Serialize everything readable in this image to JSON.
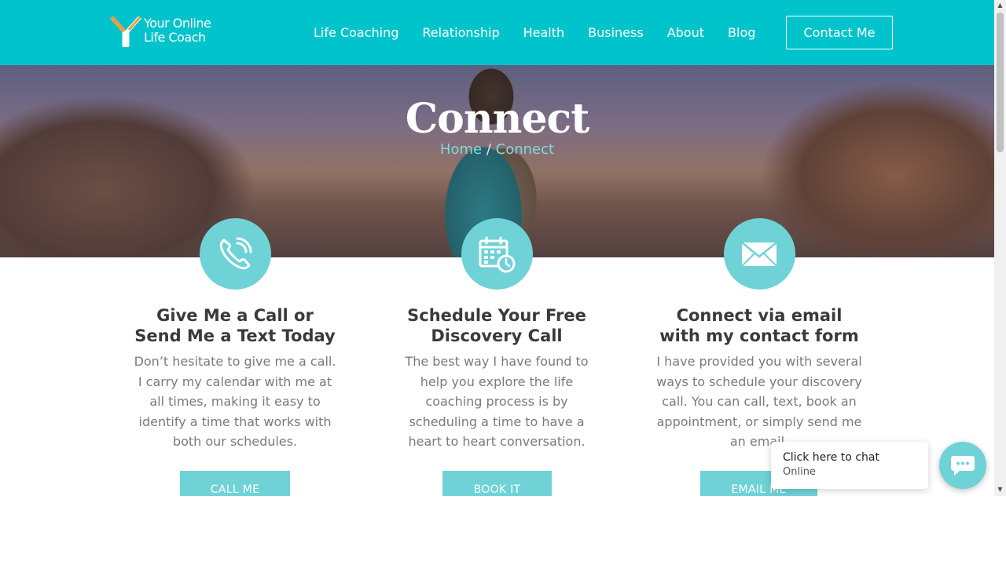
{
  "header": {
    "logo_line1": "Your Online",
    "logo_line2": "Life Coach",
    "nav": [
      "Life Coaching",
      "Relationship",
      "Health",
      "Business",
      "About",
      "Blog"
    ],
    "contact_label": "Contact Me"
  },
  "hero": {
    "title": "Connect",
    "breadcrumb_home": "Home",
    "breadcrumb_sep": "/",
    "breadcrumb_current": "Connect"
  },
  "columns": [
    {
      "icon": "phone-icon",
      "title": "Give Me a Call or Send Me a Text Today",
      "text": "Don’t hesitate to give me a call. I carry my calendar with me at all times, making it easy to identify a time that works with both our schedules.",
      "button": "CALL ME"
    },
    {
      "icon": "calendar-clock-icon",
      "title": "Schedule Your Free Discovery Call",
      "text": "The best way I have found to help you explore the life coaching process is by scheduling a time to have a heart to heart conversation.",
      "button": "BOOK IT"
    },
    {
      "icon": "envelope-icon",
      "title": "Connect via email with my contact form",
      "text": "I have provided you with several ways to schedule your discovery call. You can call, text, book an appointment, or simply send me an email.",
      "button": "EMAIL ME"
    }
  ],
  "chat": {
    "title": "Click here to chat",
    "status": "Online",
    "icon": "chat-icon"
  },
  "colors": {
    "brand_teal": "#00c3cb",
    "accent_teal": "#6fd2d6",
    "heading_text": "#3a3a3a",
    "body_text": "#7a7a7a"
  }
}
